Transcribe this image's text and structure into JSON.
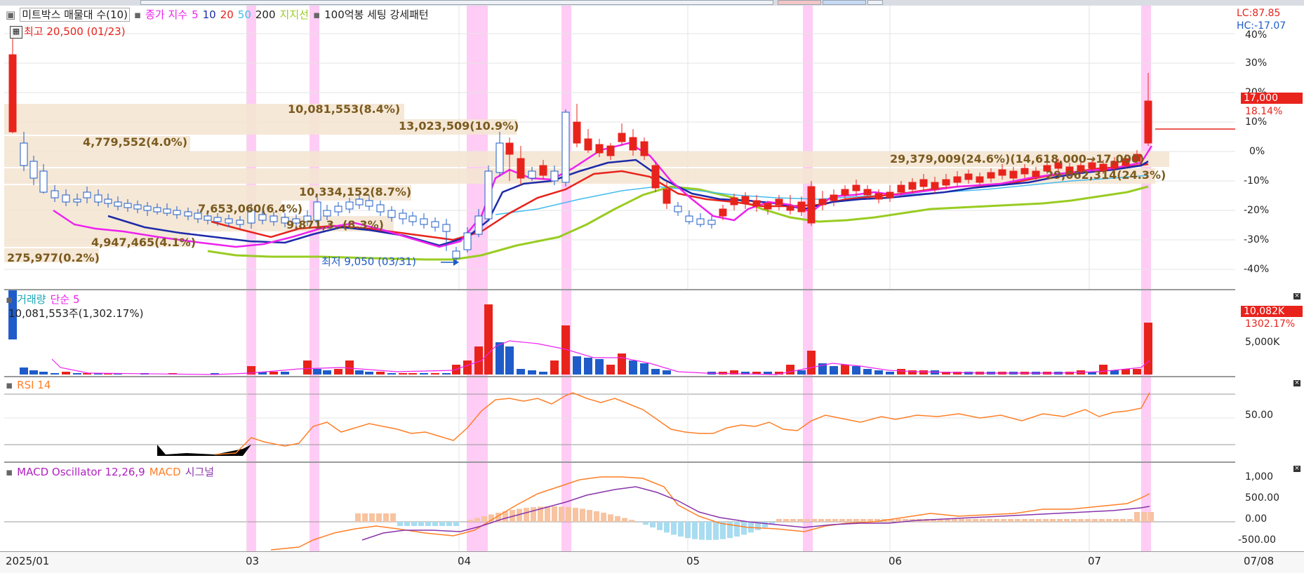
{
  "price_panel": {
    "legend": {
      "title": "미트박스 매물대 수(10)",
      "close_index": "종가 지수",
      "ma5": "5",
      "ma10": "10",
      "ma20": "20",
      "ma50": "50",
      "ma200": "200",
      "support": "지지선",
      "pattern": "100억봉 세팅 강세패턴"
    },
    "high_label": "최고 20,500 (01/23)",
    "low_label": "최저 9,050 (03/31)",
    "lc_label": "LC:87.85",
    "hc_label": "HC:-17.07",
    "price_badge": "17,000",
    "pct_badge": "18.14%",
    "y_ticks": [
      "40%",
      "30%",
      "20%",
      "10%",
      "0%",
      "-10%",
      "-20%",
      "-30%",
      "-40%"
    ],
    "volume_profile_labels": [
      "10,081,553(8.4%)",
      "13,023,509(10.9%)",
      "4,779,552(4.0%)",
      "29,379,009(24.6%)(14,618,000→17,000)",
      "29,062,314(24.3%)",
      "10,334,152(8.7%)",
      "7,653,060(6.4%)",
      "9,871,3..(8.3%)",
      "4,947,465(4.1%)",
      "275,977(0.2%)"
    ]
  },
  "volume_panel": {
    "title": "거래량",
    "ma_label": "단순 5",
    "value_label": "10,081,553주(1,302.17%)",
    "badge": "10,082K",
    "badge_pct": "1302.17%",
    "tick": "5,000K"
  },
  "rsi_panel": {
    "title": "RSI 14",
    "tick": "50.00"
  },
  "macd_panel": {
    "title": "MACD Oscillator 12,26,9",
    "macd": "MACD",
    "signal": "시그널",
    "ticks": [
      "1,000",
      "500.00",
      "0.00",
      "-500.00"
    ]
  },
  "x_axis": {
    "labels": [
      "2025/01",
      "03",
      "04",
      "05",
      "06",
      "07"
    ],
    "right_label": "07/08"
  },
  "colors": {
    "up": "#e8231c",
    "down": "#1f5cc9",
    "highlight": "#ffccf5",
    "ma5": "#ee22ee",
    "ma10": "#1c2aa8",
    "ma20": "#e8231c",
    "ma50": "#44bbee",
    "support": "#99cc22",
    "profile": "#f5e6d3",
    "rsi": "#ff7f27",
    "macd_signal": "#8833aa"
  }
}
